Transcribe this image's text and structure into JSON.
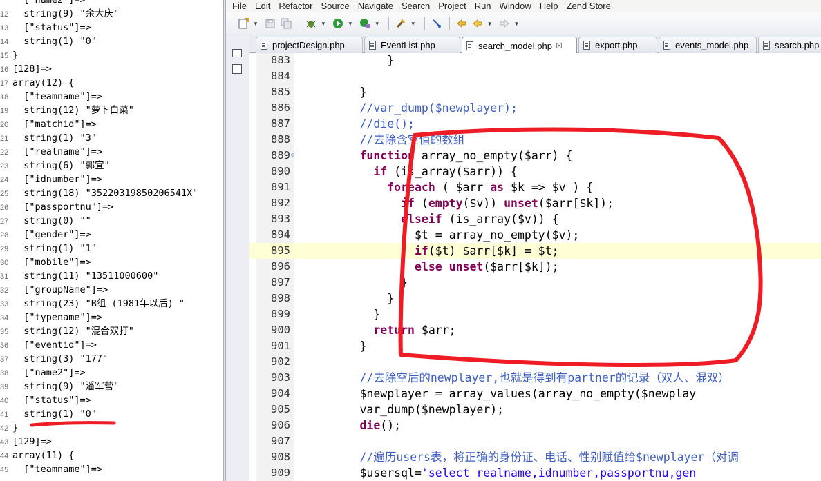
{
  "dump_panel": {
    "lines": [
      {
        "num": "",
        "text": "  [\"name2\"]=>"
      },
      {
        "num": "12",
        "text": "  string(9) \"余大庆\""
      },
      {
        "num": "13",
        "text": "  [\"status\"]=>"
      },
      {
        "num": "14",
        "text": "  string(1) \"0\""
      },
      {
        "num": "15",
        "text": "}"
      },
      {
        "num": "16",
        "text": "[128]=>"
      },
      {
        "num": "17",
        "text": "array(12) {"
      },
      {
        "num": "18",
        "text": "  [\"teamname\"]=>"
      },
      {
        "num": "19",
        "text": "  string(12) \"萝卜白菜\""
      },
      {
        "num": "20",
        "text": "  [\"matchid\"]=>"
      },
      {
        "num": "21",
        "text": "  string(1) \"3\""
      },
      {
        "num": "22",
        "text": "  [\"realname\"]=>"
      },
      {
        "num": "23",
        "text": "  string(6) \"郭宜\""
      },
      {
        "num": "24",
        "text": "  [\"idnumber\"]=>"
      },
      {
        "num": "25",
        "text": "  string(18) \"35220319850206541X\""
      },
      {
        "num": "26",
        "text": "  [\"passportnu\"]=>"
      },
      {
        "num": "27",
        "text": "  string(0) \"\""
      },
      {
        "num": "28",
        "text": "  [\"gender\"]=>"
      },
      {
        "num": "29",
        "text": "  string(1) \"1\""
      },
      {
        "num": "30",
        "text": "  [\"mobile\"]=>"
      },
      {
        "num": "31",
        "text": "  string(11) \"13511000600\""
      },
      {
        "num": "32",
        "text": "  [\"groupName\"]=>"
      },
      {
        "num": "33",
        "text": "  string(23) \"B组 (1981年以后) \""
      },
      {
        "num": "34",
        "text": "  [\"typename\"]=>"
      },
      {
        "num": "35",
        "text": "  string(12) \"混合双打\""
      },
      {
        "num": "36",
        "text": "  [\"eventid\"]=>"
      },
      {
        "num": "37",
        "text": "  string(3) \"177\""
      },
      {
        "num": "38",
        "text": "  [\"name2\"]=>"
      },
      {
        "num": "39",
        "text": "  string(9) \"潘军营\""
      },
      {
        "num": "40",
        "text": "  [\"status\"]=>"
      },
      {
        "num": "41",
        "text": "  string(1) \"0\""
      },
      {
        "num": "42",
        "text": "}"
      },
      {
        "num": "43",
        "text": "[129]=>"
      },
      {
        "num": "44",
        "text": "array(11) {"
      },
      {
        "num": "45",
        "text": "  [\"teamname\"]=>"
      }
    ]
  },
  "menu": [
    "File",
    "Edit",
    "Refactor",
    "Source",
    "Navigate",
    "Search",
    "Project",
    "Run",
    "Window",
    "Help",
    "Zend Store"
  ],
  "tabs": [
    {
      "label": "projectDesign.php",
      "active": false
    },
    {
      "label": "EventList.php",
      "active": false
    },
    {
      "label": "search_model.php",
      "active": true,
      "close": "☒"
    },
    {
      "label": "export.php",
      "active": false
    },
    {
      "label": "events_model.php",
      "active": false
    },
    {
      "label": "search.php",
      "active": false
    }
  ],
  "editor": {
    "highlighted_line": "895",
    "lines": [
      {
        "num": "883",
        "segs": [
          {
            "t": "            }"
          }
        ]
      },
      {
        "num": "884",
        "segs": [
          {
            "t": ""
          }
        ]
      },
      {
        "num": "885",
        "segs": [
          {
            "t": "        }"
          }
        ]
      },
      {
        "num": "886",
        "segs": [
          {
            "t": "        //var_dump($newplayer);",
            "c": "cm"
          }
        ]
      },
      {
        "num": "887",
        "segs": [
          {
            "t": "        //die();",
            "c": "cm"
          }
        ]
      },
      {
        "num": "888",
        "segs": [
          {
            "t": "        //去除含空值的数组",
            "c": "cm"
          }
        ]
      },
      {
        "num": "889",
        "segs": [
          {
            "t": "        "
          },
          {
            "t": "function",
            "c": "kw"
          },
          {
            "t": " array_no_empty($arr) {"
          }
        ]
      },
      {
        "num": "890",
        "segs": [
          {
            "t": "          "
          },
          {
            "t": "if",
            "c": "kw"
          },
          {
            "t": " (is_array($arr)) {"
          }
        ]
      },
      {
        "num": "891",
        "segs": [
          {
            "t": "            "
          },
          {
            "t": "foreach",
            "c": "kw"
          },
          {
            "t": " ( $arr "
          },
          {
            "t": "as",
            "c": "kw"
          },
          {
            "t": " $k => $v ) {"
          }
        ]
      },
      {
        "num": "892",
        "segs": [
          {
            "t": "              "
          },
          {
            "t": "if",
            "c": "kw"
          },
          {
            "t": " ("
          },
          {
            "t": "empty",
            "c": "kw"
          },
          {
            "t": "($v)) "
          },
          {
            "t": "unset",
            "c": "kw"
          },
          {
            "t": "($arr[$k]);"
          }
        ]
      },
      {
        "num": "893",
        "segs": [
          {
            "t": "              "
          },
          {
            "t": "elseif",
            "c": "kw"
          },
          {
            "t": " (is_array($v)) {"
          }
        ]
      },
      {
        "num": "894",
        "segs": [
          {
            "t": "                $t = array_no_empty($v);"
          }
        ]
      },
      {
        "num": "895",
        "segs": [
          {
            "t": "                "
          },
          {
            "t": "if",
            "c": "kw"
          },
          {
            "t": "($t) $arr[$k] = $t;"
          }
        ]
      },
      {
        "num": "896",
        "segs": [
          {
            "t": "                "
          },
          {
            "t": "else",
            "c": "kw"
          },
          {
            "t": " "
          },
          {
            "t": "unset",
            "c": "kw"
          },
          {
            "t": "($arr[$k]);"
          }
        ]
      },
      {
        "num": "897",
        "segs": [
          {
            "t": "              }"
          }
        ]
      },
      {
        "num": "898",
        "segs": [
          {
            "t": "            }"
          }
        ]
      },
      {
        "num": "899",
        "segs": [
          {
            "t": "          }"
          }
        ]
      },
      {
        "num": "900",
        "segs": [
          {
            "t": "          "
          },
          {
            "t": "return",
            "c": "kw"
          },
          {
            "t": " $arr;"
          }
        ]
      },
      {
        "num": "901",
        "segs": [
          {
            "t": "        }"
          }
        ]
      },
      {
        "num": "902",
        "segs": [
          {
            "t": ""
          }
        ]
      },
      {
        "num": "903",
        "segs": [
          {
            "t": "        //去除空后的",
            "c": "cm"
          },
          {
            "t": "newplayer",
            "c": "cm"
          },
          {
            "t": ",也就是得到有",
            "c": "cm"
          },
          {
            "t": "partner",
            "c": "cm"
          },
          {
            "t": "的记录（双人、混双）",
            "c": "cm"
          }
        ]
      },
      {
        "num": "904",
        "segs": [
          {
            "t": "        $newplayer = array_values(array_no_empty($newplay"
          }
        ]
      },
      {
        "num": "905",
        "segs": [
          {
            "t": "        var_dump($newplayer);"
          }
        ]
      },
      {
        "num": "906",
        "segs": [
          {
            "t": "        "
          },
          {
            "t": "die",
            "c": "kw"
          },
          {
            "t": "();"
          }
        ]
      },
      {
        "num": "907",
        "segs": [
          {
            "t": ""
          }
        ]
      },
      {
        "num": "908",
        "segs": [
          {
            "t": "        //遍历users表，将正确的身份证、电话、性别赋值给$newplayer（对调",
            "c": "cm"
          }
        ]
      },
      {
        "num": "909",
        "segs": [
          {
            "t": "        $usersql="
          },
          {
            "t": "'select realname,idnumber,passportnu,gen",
            "c": "st"
          }
        ]
      }
    ]
  },
  "colors": {
    "keyword": "#7f0055",
    "comment": "#3f5fbf",
    "string": "#2a00ff",
    "current_line": "#ffffd5",
    "annotation_red": "#ee1c24"
  }
}
